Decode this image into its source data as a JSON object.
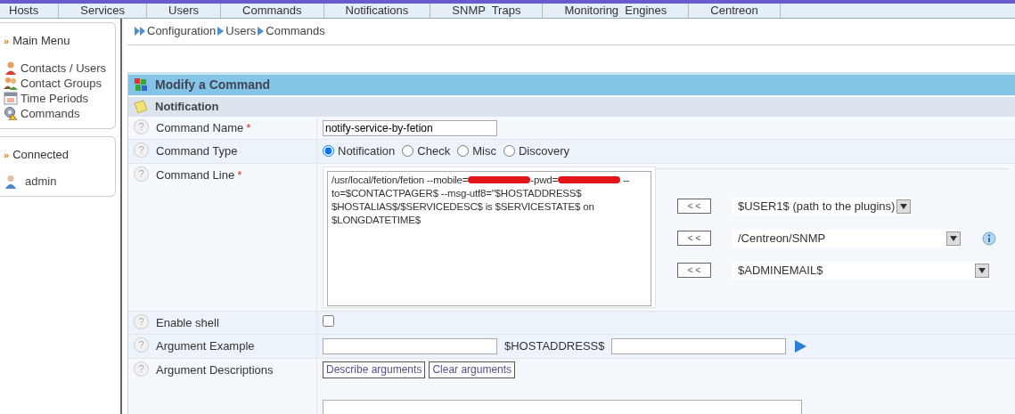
{
  "top_menu": [
    "Hosts",
    "Services",
    "Users",
    "Commands",
    "Notifications",
    "SNMP  Traps",
    "Monitoring  Engines",
    "Centreon"
  ],
  "breadcrumb": [
    "Configuration",
    "Users",
    "Commands"
  ],
  "sidebar": {
    "main_menu": {
      "marker": "»",
      "title": "Main Menu",
      "items": [
        "Contacts / Users",
        "Contact Groups",
        "Time Periods",
        "Commands"
      ]
    },
    "connected": {
      "marker": "»",
      "title": "Connected",
      "users": [
        "admin"
      ]
    }
  },
  "form": {
    "title": "Modify a Command",
    "section": "Notification",
    "command_name": {
      "help": "?",
      "label": "Command Name",
      "required_mark": "*",
      "value": "notify-service-by-fetion"
    },
    "command_type": {
      "help": "?",
      "label": "Command Type",
      "options": [
        {
          "label": "Notification",
          "selected": true
        },
        {
          "label": "Check",
          "selected": false
        },
        {
          "label": "Misc",
          "selected": false
        },
        {
          "label": "Discovery",
          "selected": false
        }
      ]
    },
    "command_line": {
      "help": "?",
      "label": "Command Line",
      "required_mark": "*",
      "parts": [
        {
          "kind": "text",
          "text": "/usr/local/fetion/fetion --mobile="
        },
        {
          "kind": "redacted"
        },
        {
          "kind": "text",
          "text": "-pwd="
        },
        {
          "kind": "redacted"
        },
        {
          "kind": "text",
          "text": " --to=$CONTACTPAGER$ --msg-utf8=\"$HOSTADDRESS$ $HOSTALIAS$/$SERVICEDESC$ is $SERVICESTATE$ on $LONGDATETIME$"
        }
      ],
      "macros": [
        {
          "button": "< <",
          "value": "$USER1$ (path to the plugins)",
          "info": false
        },
        {
          "button": "< <",
          "value": "/Centreon/SNMP",
          "info": true
        },
        {
          "button": "< <",
          "value": "$ADMINEMAIL$",
          "info": false
        }
      ]
    },
    "enable_shell": {
      "help": "?",
      "label": "Enable shell",
      "checked": false
    },
    "argument_example": {
      "help": "?",
      "label": "Argument Example",
      "middle": "$HOSTADDRESS$"
    },
    "argument_descriptions": {
      "help": "?",
      "label": "Argument Descriptions",
      "buttons": [
        "Describe arguments",
        "Clear arguments"
      ]
    }
  }
}
